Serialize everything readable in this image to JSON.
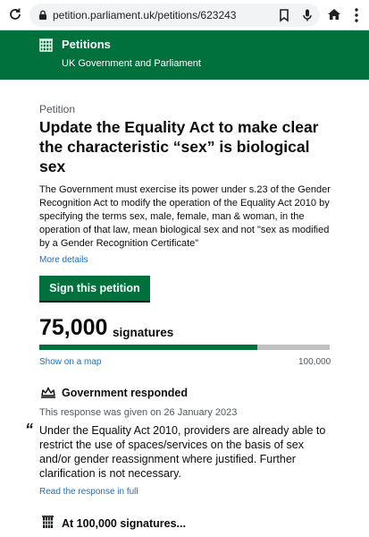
{
  "browser": {
    "url": "petition.parliament.uk/petitions/623243"
  },
  "header": {
    "brand": "Petitions",
    "subtitle": "UK Government and Parliament"
  },
  "petition": {
    "caption": "Petition",
    "title": "Update the Equality Act to make clear the characteristic “sex” is biological sex",
    "summary": "The Government must exercise its power under s.23 of the Gender Recognition Act to modify the operation of the Equality Act 2010 by specifying the terms sex, male, female, man & woman, in the operation of that law, mean biological sex and not \"sex as modified by a Gender Recognition Certificate\"",
    "more_details": "More details",
    "sign_label": "Sign this petition",
    "signature_count": "75,000",
    "signature_label": "signatures",
    "progress_fraction": 0.75,
    "map_link": "Show on a map",
    "target": "100,000"
  },
  "government": {
    "heading": "Government responded",
    "date_text": "This response was given on 26 January 2023",
    "quote_mark": "“",
    "response": "Under the Equality Act 2010, providers are already able to restrict the use of spaces/services on the basis of sex and/or gender reassignment where justified. Further clarification is not necessary.",
    "read_link": "Read the response in full"
  },
  "debate": {
    "heading": "At 100,000 signatures..."
  },
  "colors": {
    "brand_green": "#00703c",
    "link_blue": "#1d70b8",
    "progress_track": "#bfc1c3"
  }
}
